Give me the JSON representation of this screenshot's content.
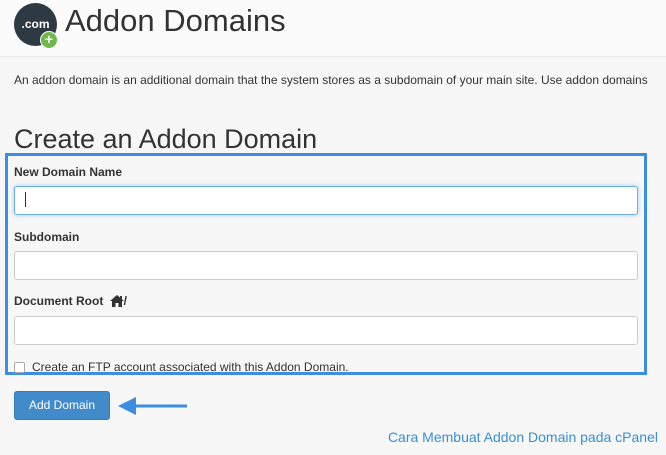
{
  "header": {
    "logo_text": ".com",
    "logo_badge": "+",
    "title": "Addon Domains"
  },
  "description": "An addon domain is an additional domain that the system stores as a subdomain of your main site. Use addon domains",
  "form": {
    "section_title": "Create an Addon Domain",
    "fields": [
      {
        "label": "New Domain Name",
        "value": "",
        "placeholder": ""
      },
      {
        "label": "Subdomain",
        "value": "",
        "placeholder": ""
      },
      {
        "label": "Document Root",
        "value": "",
        "placeholder": "",
        "path_suffix": "/"
      }
    ],
    "ftp_checkbox_label": "Create an FTP account associated with this Addon Domain.",
    "ftp_checked": false,
    "submit_label": "Add Domain"
  },
  "caption": "Cara Membuat Addon Domain pada cPanel",
  "icons": {
    "logo": "domain-com-icon",
    "badge": "plus-badge-icon",
    "home": "home-icon",
    "arrow": "arrow-left-icon"
  },
  "colors": {
    "highlight": "#3b8fe2",
    "button": "#428bca",
    "caption": "#3a8ed6",
    "logo_bg": "#2d3a44",
    "badge_bg": "#6fb84a"
  }
}
